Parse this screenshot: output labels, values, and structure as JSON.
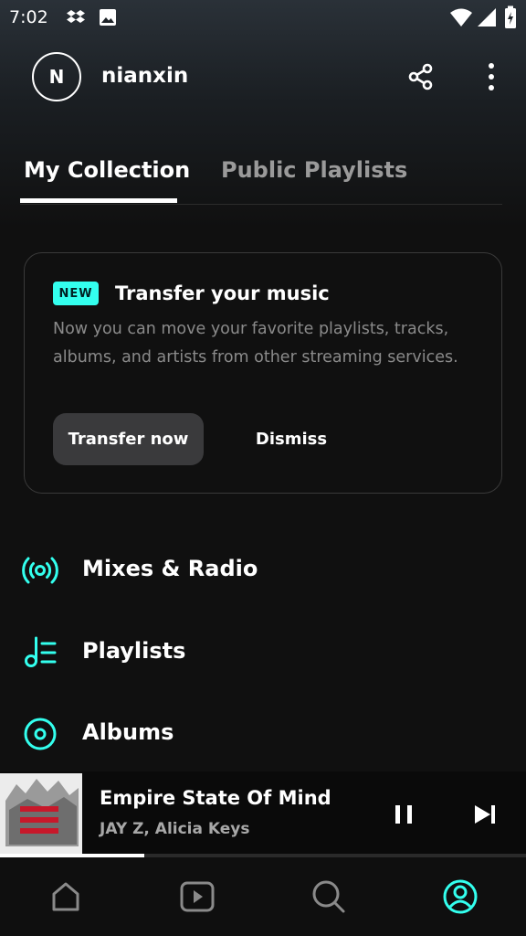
{
  "status_bar": {
    "time": "7:02"
  },
  "profile": {
    "initial": "N",
    "username": "nianxin"
  },
  "tabs": [
    {
      "label": "My Collection",
      "active": true
    },
    {
      "label": "Public Playlists",
      "active": false
    }
  ],
  "transfer_card": {
    "badge": "NEW",
    "title": "Transfer your music",
    "description": "Now you can move your favorite playlists, tracks, albums, and artists from other streaming services.",
    "primary_button": "Transfer now",
    "secondary_button": "Dismiss"
  },
  "menu": [
    {
      "label": "Mixes & Radio",
      "icon": "radio-broadcast-icon"
    },
    {
      "label": "Playlists",
      "icon": "playlist-icon"
    },
    {
      "label": "Albums",
      "icon": "album-disc-icon"
    }
  ],
  "now_playing": {
    "title": "Empire State Of Mind",
    "artist": "JAY Z, Alicia Keys",
    "progress": 0.275,
    "state": "playing"
  },
  "bottom_nav": [
    {
      "name": "home",
      "icon": "home-icon",
      "active": false
    },
    {
      "name": "videos",
      "icon": "play-video-icon",
      "active": false
    },
    {
      "name": "search",
      "icon": "search-icon",
      "active": false
    },
    {
      "name": "my-collection",
      "icon": "profile-icon",
      "active": true
    }
  ],
  "colors": {
    "accent": "#33ffee",
    "background": "#101010",
    "card_border": "#3a3a3a"
  }
}
